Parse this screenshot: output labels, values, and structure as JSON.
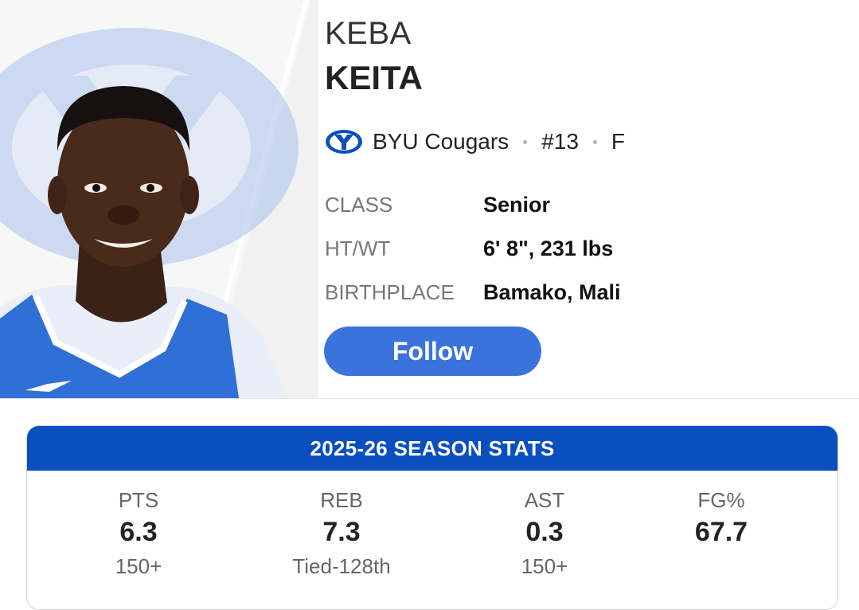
{
  "player": {
    "first_name": "KEBA",
    "last_name": "KEITA",
    "team": "BYU Cougars",
    "number": "#13",
    "position": "F",
    "team_logo_icon": "byu-y-logo-icon",
    "team_color": "#0a4fbf"
  },
  "info": [
    {
      "label": "CLASS",
      "value": "Senior"
    },
    {
      "label": "HT/WT",
      "value": "6' 8\", 231 lbs"
    },
    {
      "label": "BIRTHPLACE",
      "value": "Bamako, Mali"
    }
  ],
  "follow_label": "Follow",
  "season_stats": {
    "title": "2025-26 SEASON STATS",
    "stats": [
      {
        "label": "PTS",
        "value": "6.3",
        "rank": "150+"
      },
      {
        "label": "REB",
        "value": "7.3",
        "rank": "Tied-128th"
      },
      {
        "label": "AST",
        "value": "0.3",
        "rank": "150+"
      },
      {
        "label": "FG%",
        "value": "67.7",
        "rank": ""
      }
    ]
  },
  "colors": {
    "accent": "#3b73dd",
    "header": "#0a4fbf"
  }
}
